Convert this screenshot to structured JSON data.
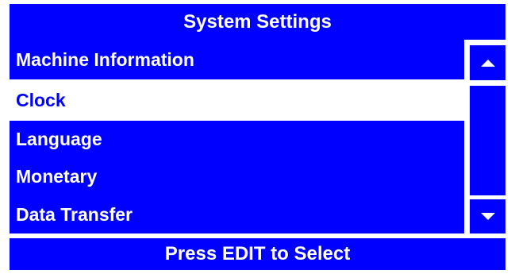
{
  "screen": {
    "title": "System Settings",
    "footer": "Press EDIT to Select"
  },
  "menu": {
    "items": [
      {
        "label": "Machine Information",
        "selected": false
      },
      {
        "label": "Clock",
        "selected": true
      },
      {
        "label": "Language",
        "selected": false
      },
      {
        "label": "Monetary",
        "selected": false
      },
      {
        "label": "Data Transfer",
        "selected": false
      }
    ]
  },
  "scrollbar": {
    "up_icon": "triangle-up-icon",
    "down_icon": "triangle-down-icon"
  },
  "colors": {
    "accent": "#0000ff",
    "text_on_accent": "#ffffff",
    "selected_background": "#ffffff"
  }
}
